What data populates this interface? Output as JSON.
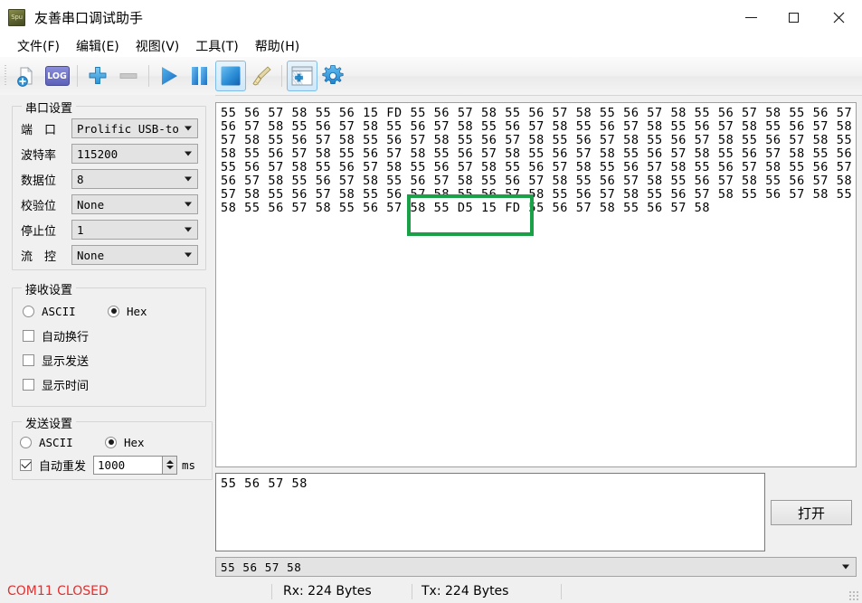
{
  "window": {
    "title": "友善串口调试助手",
    "icon_text": "Spu",
    "minimize": "—",
    "maximize": "□",
    "close": "✕"
  },
  "menu": [
    {
      "label": "文件(F)",
      "name": "menu-file"
    },
    {
      "label": "编辑(E)",
      "name": "menu-edit"
    },
    {
      "label": "视图(V)",
      "name": "menu-view"
    },
    {
      "label": "工具(T)",
      "name": "menu-tools"
    },
    {
      "label": "帮助(H)",
      "name": "menu-help"
    }
  ],
  "toolbar": {
    "log_label": "LOG",
    "items": [
      {
        "name": "new-file-icon",
        "state": "enabled"
      },
      {
        "name": "log-icon",
        "state": "enabled"
      },
      {
        "name": "add-icon",
        "state": "enabled"
      },
      {
        "name": "remove-icon",
        "state": "disabled"
      },
      {
        "name": "play-icon",
        "state": "enabled"
      },
      {
        "name": "pause-icon",
        "state": "enabled"
      },
      {
        "name": "stop-icon",
        "state": "selected"
      },
      {
        "name": "clear-broom-icon",
        "state": "enabled"
      },
      {
        "name": "new-window-icon",
        "state": "selected"
      },
      {
        "name": "settings-gear-icon",
        "state": "enabled"
      }
    ]
  },
  "port_settings": {
    "title": "串口设置",
    "fields": [
      {
        "label": "端　口",
        "value": "Prolific USB-to",
        "name": "port-select"
      },
      {
        "label": "波特率",
        "value": "115200",
        "name": "baudrate-select"
      },
      {
        "label": "数据位",
        "value": "8",
        "name": "databits-select"
      },
      {
        "label": "校验位",
        "value": "None",
        "name": "parity-select"
      },
      {
        "label": "停止位",
        "value": "1",
        "name": "stopbits-select"
      },
      {
        "label": "流　控",
        "value": "None",
        "name": "flowcontrol-select"
      }
    ]
  },
  "receive_settings": {
    "title": "接收设置",
    "ascii_label": "ASCII",
    "hex_label": "Hex",
    "ascii_selected": false,
    "hex_selected": true,
    "checkboxes": [
      {
        "label": "自动换行",
        "checked": false,
        "name": "auto-wrap-checkbox"
      },
      {
        "label": "显示发送",
        "checked": false,
        "name": "show-send-checkbox"
      },
      {
        "label": "显示时间",
        "checked": false,
        "name": "show-time-checkbox"
      }
    ]
  },
  "send_settings": {
    "title": "发送设置",
    "ascii_label": "ASCII",
    "hex_label": "Hex",
    "ascii_selected": false,
    "hex_selected": true,
    "auto_resend_label": "自动重发",
    "auto_resend_checked": true,
    "interval_value": "1000",
    "interval_unit": "ms"
  },
  "receive_area": {
    "lines": [
      "55 56 57 58 55 56 15 FD 55 56 57 58 55 56 57 58 55 56 57 58 55 56 57 58 55 56 57 58 55",
      "56 57 58 55 56 57 58 55 56 57 58 55 56 57 58 55 56 57 58 55 56 57 58 55 56 57 58 55 56",
      "57 58 55 56 57 58 55 56 57 58 55 56 57 58 55 56 57 58 55 56 57 58 55 56 57 58 55 56 57",
      "58 55 56 57 58 55 56 57 58 55 56 57 58 55 56 57 58 55 56 57 58 55 56 57 58 55 56 57 58",
      "55 56 57 58 55 56 57 58 55 56 57 58 55 56 57 58 55 56 57 58 55 56 57 58 55 56 57 58 55",
      "56 57 58 55 56 57 58 55 56 57 58 55 56 57 58 55 56 57 58 55 56 57 58 55 56 57 58 55 56",
      "57 58 55 56 57 58 55 56 57 58 55 56 57 58 55 56 57 58 55 56 57 58 55 56 57 58 55 56 57",
      "58 55 56 57 58 55 56 57 58 55 D5 15 FD 55 56 57 58 55 56 57 58"
    ],
    "highlight_color": "#1aa148"
  },
  "send_area": {
    "text": "55 56 57 58"
  },
  "open_button": {
    "label": "打开"
  },
  "history_combo": {
    "value": "55 56 57 58"
  },
  "statusbar": {
    "connection": "COM11 CLOSED",
    "connection_color": "#e03030",
    "rx": "Rx: 224 Bytes",
    "tx": "Tx: 224 Bytes"
  }
}
